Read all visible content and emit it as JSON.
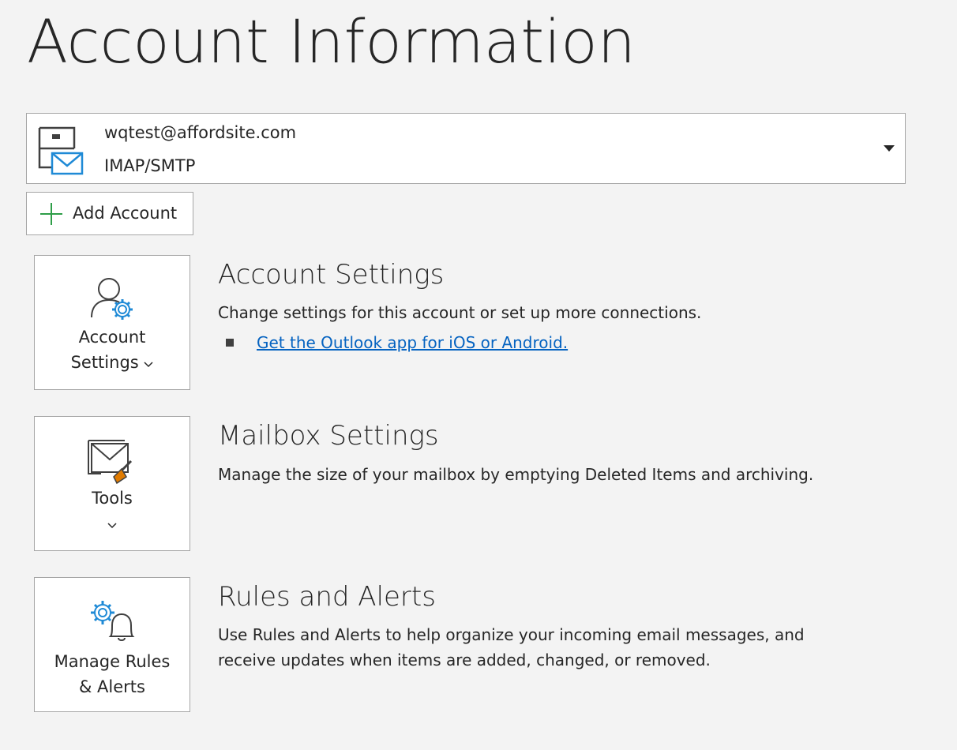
{
  "page": {
    "title": "Account Information"
  },
  "account": {
    "email": "wqtest@affordsite.com",
    "type": "IMAP/SMTP",
    "icon": "mailbox-account-icon"
  },
  "add_account": {
    "label": "Add Account",
    "icon": "plus-icon"
  },
  "sections": {
    "account_settings": {
      "tile_label_line1": "Account",
      "tile_label_line2": "Settings",
      "title": "Account Settings",
      "description": "Change settings for this account or set up more connections.",
      "link": "Get the Outlook app for iOS or Android.",
      "icon": "user-gear-icon"
    },
    "mailbox_settings": {
      "tile_label": "Tools",
      "title": "Mailbox Settings",
      "description": "Manage the size of your mailbox by emptying Deleted Items and archiving.",
      "icon": "mailbox-broom-icon"
    },
    "rules_alerts": {
      "tile_label_line1": "Manage Rules",
      "tile_label_line2": "& Alerts",
      "title": "Rules and Alerts",
      "description_line1": "Use Rules and Alerts to help organize your incoming email messages, and",
      "description_line2": "receive updates when items are added, changed, or removed.",
      "icon": "gear-bell-icon"
    }
  },
  "colors": {
    "background": "#f3f3f3",
    "link": "#0563c1",
    "accent_blue": "#1f8ad6",
    "accent_green": "#2e9e48",
    "accent_orange": "#e07b00"
  }
}
